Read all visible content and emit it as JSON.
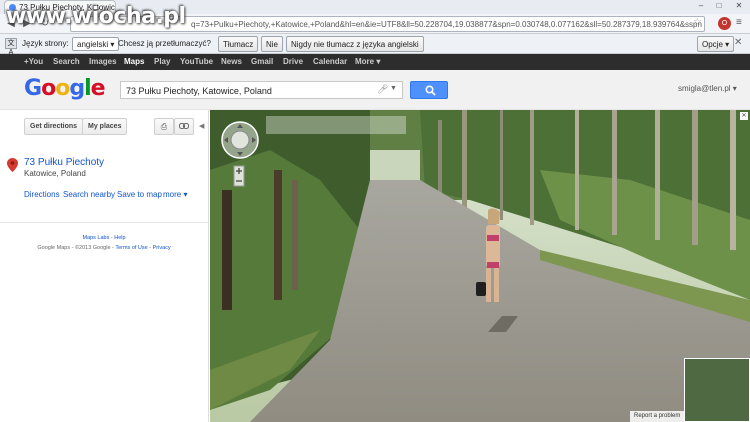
{
  "browser": {
    "tab_title": "73 Pułku Piechoty, Katowic",
    "url": "q=73+Pulku+Piechoty,+Katowice,+Poland&hl=en&ie=UTF8&ll=50.228704,19.038877&spn=0.030748,0.077162&sll=50.287379,18.939764&sspn",
    "minimize": "–",
    "maximize": "□",
    "close": "✕",
    "back": "◀",
    "forward": "▶",
    "reload": "↻",
    "star": "☆",
    "ext_label": "O",
    "menu": "≡"
  },
  "watermark": "www.wiocha.pl",
  "translate_bar": {
    "icon_text": "文A",
    "language_label": "Język strony:",
    "language_value": "angielski ▾",
    "question": "Chcesz ją przetłumaczyć?",
    "translate_button": "Tłumacz",
    "no_button": "Nie",
    "never_button": "Nigdy nie tłumacz z języka angielski",
    "options_button": "Opcje ▾",
    "close": "✕"
  },
  "google_bar": {
    "items": [
      "+You",
      "Search",
      "Images",
      "Maps",
      "Play",
      "YouTube",
      "News",
      "Gmail",
      "Drive",
      "Calendar",
      "More ▾"
    ],
    "active_index": 3
  },
  "header": {
    "logo_letters": [
      "G",
      "o",
      "o",
      "g",
      "l",
      "e"
    ],
    "logo_colors": [
      "#3369e8",
      "#d50f25",
      "#eeb211",
      "#3369e8",
      "#009925",
      "#d50f25"
    ],
    "search_value": "73 Pułku Piechoty, Katowice, Poland",
    "account": "smigla@tlen.pl ▾"
  },
  "sidepanel": {
    "get_directions": "Get directions",
    "my_places": "My places",
    "print_icon": "⎙",
    "link_icon": "🔗",
    "collapse": "◀",
    "place_name": "73 Pułku Piechoty",
    "place_sub": "Katowice, Poland",
    "actions": [
      "Directions",
      "Search nearby",
      "Save to map",
      "more ▾"
    ],
    "maps_labs": "Maps Labs",
    "help": "Help",
    "copyright": "Google Maps - ©2013 Google - ",
    "terms": "Terms of Use",
    "privacy": "Privacy"
  },
  "streetview": {
    "corner": "✕",
    "report": "Report a problem"
  },
  "colors": {
    "accent_blue": "#4d90fe",
    "link_blue": "#1155cc",
    "marker_red": "#d23b2e"
  }
}
